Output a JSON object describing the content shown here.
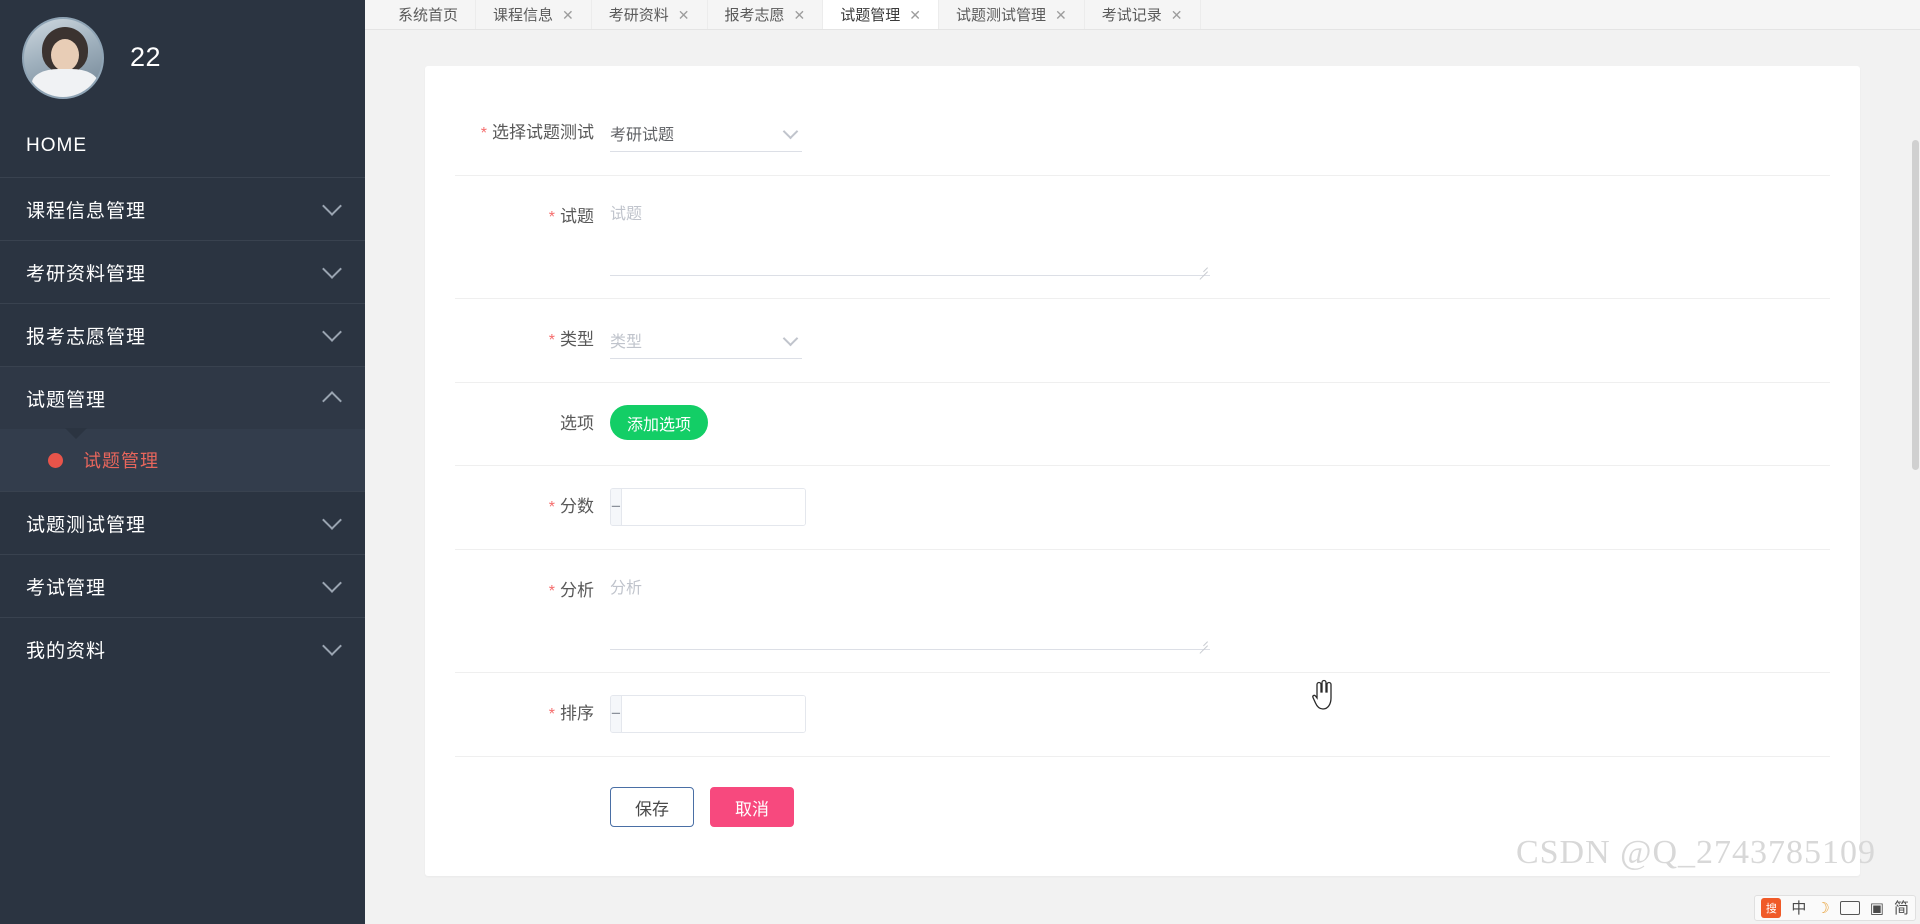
{
  "sidebar": {
    "user": {
      "name": "22",
      "avatar_alt": "user-avatar"
    },
    "home_label": "HOME",
    "items": [
      {
        "label": "课程信息管理",
        "icon": "chevron-down-icon"
      },
      {
        "label": "考研资料管理",
        "icon": "chevron-down-icon"
      },
      {
        "label": "报考志愿管理",
        "icon": "chevron-down-icon"
      },
      {
        "label": "试题管理",
        "icon": "chevron-up-icon",
        "expanded": true
      },
      {
        "label": "试题测试管理",
        "icon": "chevron-down-icon"
      },
      {
        "label": "考试管理",
        "icon": "chevron-down-icon"
      },
      {
        "label": "我的资料",
        "icon": "chevron-down-icon"
      }
    ],
    "submenu": [
      {
        "label": "试题管理",
        "active": true,
        "icon": "dot-icon"
      }
    ]
  },
  "tabs": [
    {
      "label": "系统首页",
      "closable": false,
      "active": false
    },
    {
      "label": "课程信息",
      "closable": true,
      "active": false
    },
    {
      "label": "考研资料",
      "closable": true,
      "active": false
    },
    {
      "label": "报考志愿",
      "closable": true,
      "active": false
    },
    {
      "label": "试题管理",
      "closable": true,
      "active": true
    },
    {
      "label": "试题测试管理",
      "closable": true,
      "active": false
    },
    {
      "label": "考试记录",
      "closable": true,
      "active": false
    }
  ],
  "form": {
    "select_test": {
      "label": "选择试题测试",
      "required": true,
      "value": "考研试题",
      "icon": "chevron-down-icon"
    },
    "question": {
      "label": "试题",
      "required": true,
      "value": "",
      "placeholder": "试题"
    },
    "type": {
      "label": "类型",
      "required": true,
      "value": "",
      "placeholder": "类型",
      "icon": "chevron-down-icon"
    },
    "options": {
      "label": "选项",
      "required": false,
      "add_button": "添加选项"
    },
    "score": {
      "label": "分数",
      "required": true,
      "value": "",
      "minus": "−",
      "plus": "+"
    },
    "analysis": {
      "label": "分析",
      "required": true,
      "value": "",
      "placeholder": "分析"
    },
    "sort": {
      "label": "排序",
      "required": true,
      "value": "",
      "minus": "−",
      "plus": "+"
    },
    "required_mark": "*",
    "save_label": "保存",
    "cancel_label": "取消"
  },
  "watermark": "CSDN @Q_2743785109",
  "ime": {
    "logo": "搜",
    "mode": "中",
    "moon": "☽",
    "keyboard_icon": "keyboard-icon",
    "tool_icon": "▣",
    "menu_icon": "简"
  },
  "colors": {
    "sidebar_bg": "#2b3441",
    "submenu_bg": "#333d4c",
    "accent_red": "#e8544a",
    "green": "#13ce66",
    "pink": "#f7497e",
    "save_border": "#4a6fa5"
  }
}
